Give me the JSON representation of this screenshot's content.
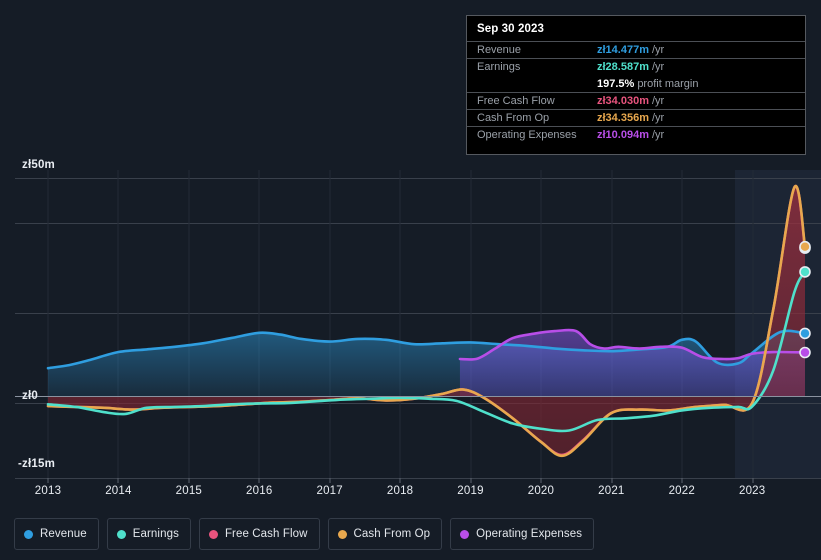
{
  "chart_data": {
    "type": "area",
    "title": "",
    "xlabel": "",
    "ylabel": "",
    "currency_symbol": "zł",
    "grid": true,
    "legend_position": "bottom",
    "x_axis": {
      "tick_labels": [
        "2013",
        "2014",
        "2015",
        "2016",
        "2017",
        "2018",
        "2019",
        "2020",
        "2021",
        "2022",
        "2023"
      ],
      "range": [
        2012.6,
        2023.9
      ]
    },
    "y_axis": {
      "tick_labels": [
        "zł50m",
        "zł0",
        "-zł15m"
      ],
      "tick_values": [
        50,
        0,
        -15
      ],
      "ylim": [
        -18,
        55
      ],
      "gridline_values": [
        50,
        35,
        5
      ]
    },
    "forecast_band_start": "2023.0",
    "series": [
      {
        "name": "Revenue",
        "color": "#2f9ee0",
        "fill": "#1d4c6e",
        "end_value": 14.477,
        "x": [
          2013.0,
          2013.3,
          2013.6,
          2014.0,
          2014.4,
          2014.8,
          2015.2,
          2015.6,
          2016.0,
          2016.3,
          2016.6,
          2017.0,
          2017.4,
          2017.8,
          2018.2,
          2018.6,
          2019.0,
          2019.4,
          2019.8,
          2020.2,
          2020.6,
          2021.0,
          2021.4,
          2021.8,
          2022.0,
          2022.2,
          2022.5,
          2022.8,
          2023.0,
          2023.4,
          2023.75
        ],
        "y": [
          6.5,
          7.2,
          8.4,
          10.2,
          10.8,
          11.4,
          12.2,
          13.4,
          14.6,
          14.2,
          13.2,
          12.6,
          13.2,
          13.0,
          12.0,
          12.2,
          12.4,
          12.0,
          11.6,
          11.0,
          10.6,
          10.4,
          10.8,
          11.4,
          13.0,
          12.6,
          7.8,
          7.6,
          10.0,
          14.8,
          14.477
        ]
      },
      {
        "name": "Earnings",
        "color": "#4fe0cb",
        "fill": "#1f5f5c",
        "end_value": 28.587,
        "x": [
          2013.0,
          2013.4,
          2013.8,
          2014.1,
          2014.4,
          2014.8,
          2015.2,
          2015.6,
          2016.0,
          2016.4,
          2016.8,
          2017.2,
          2017.6,
          2018.0,
          2018.4,
          2018.8,
          2019.2,
          2019.6,
          2020.0,
          2020.4,
          2020.8,
          2021.2,
          2021.6,
          2022.0,
          2022.4,
          2022.8,
          2023.0,
          2023.3,
          2023.6,
          2023.75
        ],
        "y": [
          -1.8,
          -2.4,
          -3.6,
          -4.0,
          -2.6,
          -2.4,
          -2.2,
          -1.8,
          -1.6,
          -1.5,
          -1.1,
          -0.7,
          -0.5,
          -0.3,
          -0.5,
          -1.0,
          -3.6,
          -6.2,
          -7.4,
          -7.8,
          -5.4,
          -5.0,
          -4.4,
          -3.2,
          -2.6,
          -2.4,
          -2.3,
          6.0,
          24.0,
          28.587
        ]
      },
      {
        "name": "Free Cash Flow",
        "color": "#e8547e",
        "fill": "#5e2028",
        "end_value": 34.03,
        "x": [
          2013.0,
          2013.4,
          2013.8,
          2014.2,
          2014.6,
          2015.0,
          2015.4,
          2015.8,
          2016.2,
          2016.6,
          2017.0,
          2017.4,
          2017.8,
          2018.2,
          2018.6,
          2018.9,
          2019.2,
          2019.6,
          2020.0,
          2020.3,
          2020.6,
          2021.0,
          2021.4,
          2021.8,
          2022.2,
          2022.6,
          2023.0,
          2023.3,
          2023.6,
          2023.75
        ],
        "y": [
          -2.2,
          -2.4,
          -2.6,
          -3.0,
          -2.6,
          -2.4,
          -2.2,
          -1.8,
          -1.4,
          -1.2,
          -0.8,
          -0.4,
          -0.9,
          -0.5,
          0.6,
          1.6,
          -0.4,
          -5.0,
          -10.4,
          -13.4,
          -10.0,
          -3.8,
          -3.0,
          -3.2,
          -2.4,
          -1.9,
          -1.5,
          20.0,
          48.0,
          34.03
        ]
      },
      {
        "name": "Cash From Op",
        "color": "#e8a84e",
        "fill": "#6b5230",
        "end_value": 34.356,
        "x": [
          2013.0,
          2013.4,
          2013.8,
          2014.2,
          2014.6,
          2015.0,
          2015.4,
          2015.8,
          2016.2,
          2016.6,
          2017.0,
          2017.4,
          2017.8,
          2018.2,
          2018.6,
          2018.9,
          2019.2,
          2019.6,
          2020.0,
          2020.3,
          2020.6,
          2021.0,
          2021.4,
          2021.8,
          2022.2,
          2022.6,
          2023.0,
          2023.3,
          2023.6,
          2023.75
        ],
        "y": [
          -2.2,
          -2.4,
          -2.6,
          -3.0,
          -2.6,
          -2.4,
          -2.2,
          -1.8,
          -1.4,
          -1.2,
          -0.8,
          -0.4,
          -0.9,
          -0.5,
          0.6,
          1.6,
          -0.4,
          -5.0,
          -10.4,
          -13.6,
          -10.2,
          -3.8,
          -3.0,
          -3.2,
          -2.4,
          -1.9,
          -1.5,
          20.0,
          48.0,
          34.356
        ]
      },
      {
        "name": "Operating Expenses",
        "color": "#b84ee8",
        "fill": "#3c2a72",
        "end_value": 10.094,
        "x": [
          2018.85,
          2019.1,
          2019.35,
          2019.6,
          2019.9,
          2020.2,
          2020.5,
          2020.7,
          2020.9,
          2021.1,
          2021.4,
          2021.7,
          2022.0,
          2022.3,
          2022.6,
          2022.8,
          2023.0,
          2023.3,
          2023.75
        ],
        "y": [
          8.6,
          8.7,
          11.0,
          13.4,
          14.4,
          15.0,
          15.0,
          12.0,
          11.0,
          11.4,
          11.0,
          11.4,
          11.2,
          9.0,
          8.6,
          8.8,
          9.8,
          10.2,
          10.094
        ]
      }
    ]
  },
  "tooltip": {
    "title": "Sep 30 2023",
    "unit_suffix": "/yr",
    "rows": [
      {
        "label": "Revenue",
        "value": "zł14.477m",
        "color": "#2f9ee0"
      },
      {
        "label": "Earnings",
        "value": "zł28.587m",
        "color": "#4fe0cb"
      },
      {
        "label": "Free Cash Flow",
        "value": "zł34.030m",
        "color": "#e8547e"
      },
      {
        "label": "Cash From Op",
        "value": "zł34.356m",
        "color": "#e8a84e"
      },
      {
        "label": "Operating Expenses",
        "value": "zł10.094m",
        "color": "#b84ee8"
      }
    ],
    "profit_margin_value": "197.5%",
    "profit_margin_label": "profit margin"
  },
  "legend": {
    "items": [
      {
        "label": "Revenue",
        "color": "#2f9ee0",
        "icon": "legend-dot-icon"
      },
      {
        "label": "Earnings",
        "color": "#4fe0cb",
        "icon": "legend-dot-icon"
      },
      {
        "label": "Free Cash Flow",
        "color": "#e8547e",
        "icon": "legend-dot-icon"
      },
      {
        "label": "Cash From Op",
        "color": "#e8a84e",
        "icon": "legend-dot-icon"
      },
      {
        "label": "Operating Expenses",
        "color": "#b84ee8",
        "icon": "legend-dot-icon"
      }
    ]
  },
  "axis": {
    "y_top": "zł50m",
    "y_zero": "zł0",
    "y_bottom": "-zł15m",
    "x_ticks": [
      "2013",
      "2014",
      "2015",
      "2016",
      "2017",
      "2018",
      "2019",
      "2020",
      "2021",
      "2022",
      "2023"
    ]
  },
  "colors": {
    "background": "#151c26",
    "gridline": "#39404b",
    "zero_line": "#8b93a0",
    "forecast_band": "#1b2433"
  }
}
